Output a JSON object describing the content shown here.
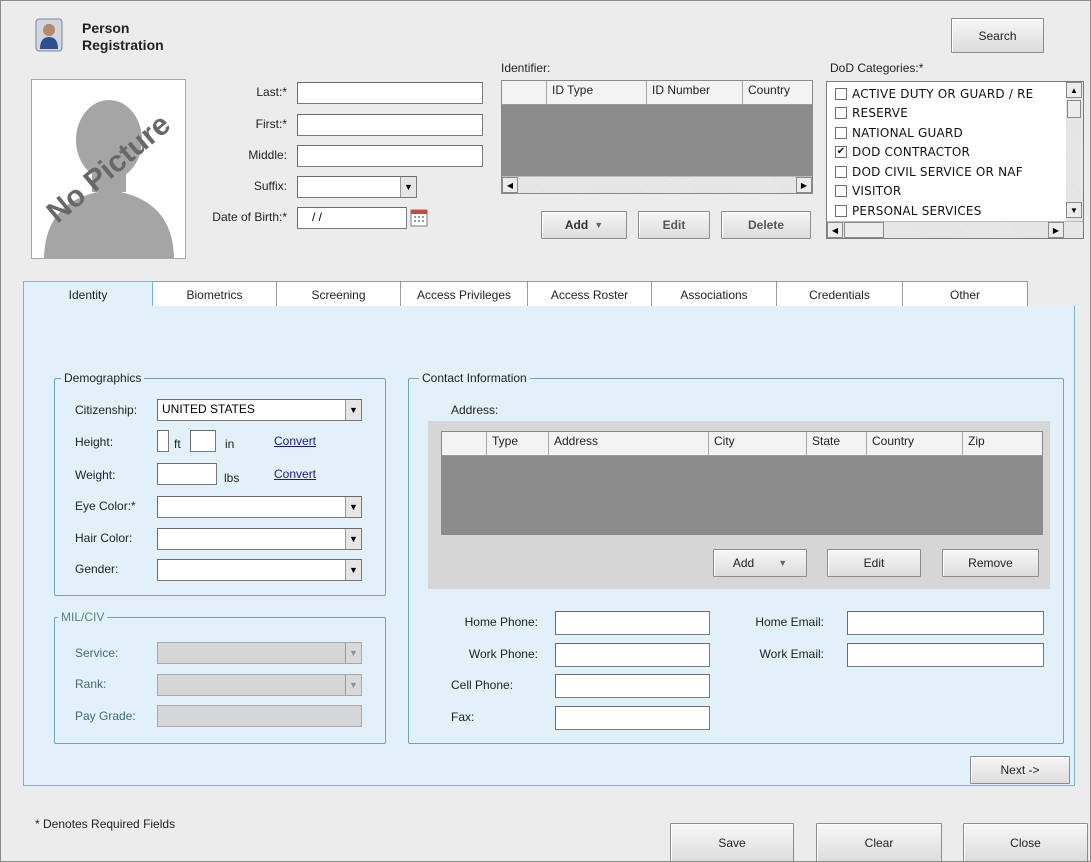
{
  "header": {
    "title_line1": "Person",
    "title_line2": "Registration",
    "search_label": "Search",
    "photo_text": "No Picture"
  },
  "person": {
    "last_label": "Last:*",
    "first_label": "First:*",
    "middle_label": "Middle:",
    "suffix_label": "Suffix:",
    "dob_label": "Date of Birth:*",
    "last_value": "",
    "first_value": "",
    "middle_value": "",
    "suffix_value": "",
    "dob_value": "/ /"
  },
  "identifier": {
    "label": "Identifier:",
    "columns": [
      "",
      "ID Type",
      "ID Number",
      "Country"
    ],
    "add_label": "Add",
    "edit_label": "Edit",
    "delete_label": "Delete"
  },
  "dod": {
    "label": "DoD Categories:*",
    "items": [
      {
        "text": "ACTIVE DUTY OR GUARD / RE",
        "checked": false,
        "mark": ""
      },
      {
        "text": "RESERVE",
        "checked": false,
        "mark": ""
      },
      {
        "text": "NATIONAL GUARD",
        "checked": false,
        "mark": ""
      },
      {
        "text": "DOD CONTRACTOR",
        "checked": true,
        "mark": "✔"
      },
      {
        "text": "DOD CIVIL SERVICE OR NAF",
        "checked": false,
        "mark": ""
      },
      {
        "text": "VISITOR",
        "checked": false,
        "mark": ""
      },
      {
        "text": "PERSONAL SERVICES",
        "checked": false,
        "mark": ""
      }
    ]
  },
  "tabs": [
    "Identity",
    "Biometrics",
    "Screening",
    "Access Privileges",
    "Access Roster",
    "Associations",
    "Credentials",
    "Other"
  ],
  "demographics": {
    "title": "Demographics",
    "citizenship_label": "Citizenship:",
    "citizenship_value": "UNITED STATES",
    "height_label": "Height:",
    "ft_unit": "ft",
    "in_unit": "in",
    "weight_label": "Weight:",
    "lbs_unit": "lbs",
    "convert_label": "Convert",
    "eye_label": "Eye Color:*",
    "hair_label": "Hair Color:",
    "gender_label": "Gender:"
  },
  "milciv": {
    "title": "MIL/CIV",
    "service_label": "Service:",
    "rank_label": "Rank:",
    "paygrade_label": "Pay Grade:"
  },
  "contact": {
    "title": "Contact Information",
    "address_label": "Address:",
    "columns": [
      "",
      "Type",
      "Address",
      "City",
      "State",
      "Country",
      "Zip"
    ],
    "add_label": "Add",
    "edit_label": "Edit",
    "remove_label": "Remove",
    "home_phone_label": "Home Phone:",
    "work_phone_label": "Work Phone:",
    "cell_phone_label": "Cell Phone:",
    "fax_label": "Fax:",
    "home_email_label": "Home Email:",
    "work_email_label": "Work Email:"
  },
  "footer": {
    "next_label": "Next ->",
    "required_note": "* Denotes Required Fields",
    "save_label": "Save",
    "clear_label": "Clear",
    "close_label": "Close"
  }
}
